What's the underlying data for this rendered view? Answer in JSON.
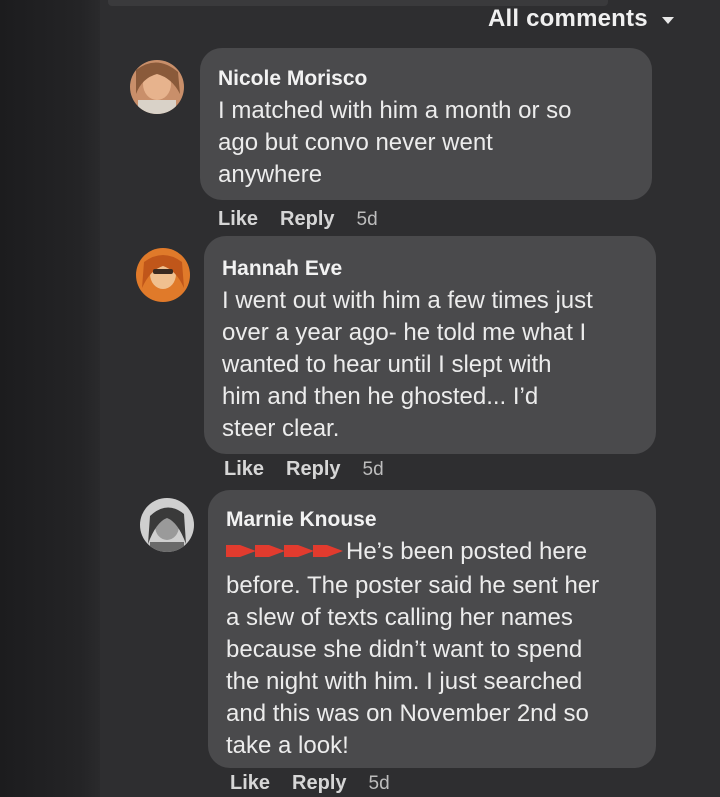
{
  "header": {
    "sort_label": "All comments"
  },
  "comments": [
    {
      "author": "Nicole Morisco",
      "lines": [
        "I matched with him a month or so",
        "ago but convo never went",
        "anywhere"
      ],
      "like": "Like",
      "reply": "Reply",
      "time": "5d"
    },
    {
      "author": "Hannah Eve",
      "lines": [
        "I went out with him a few times just",
        "over a year ago- he told me what I",
        "wanted to hear until I slept with",
        "him and then he ghosted... I’d",
        "steer clear."
      ],
      "like": "Like",
      "reply": "Reply",
      "time": "5d"
    },
    {
      "author": "Marnie Knouse",
      "lines": [
        "He’s been posted here",
        "before. The poster said he sent her",
        "a slew of texts calling her names",
        "because she didn’t want to spend",
        "the night with him. I just searched",
        "and this was on November 2nd so",
        "take a look!"
      ],
      "like": "Like",
      "reply": "Reply",
      "time": "5d",
      "prefix_icons": [
        "red-arrow-icon",
        "red-arrow-icon",
        "red-arrow-icon",
        "red-arrow-icon"
      ]
    }
  ],
  "colors": {
    "background": "#2e2e30",
    "bubble": "#4a4a4c",
    "arrow_red": "#e23b2e"
  }
}
